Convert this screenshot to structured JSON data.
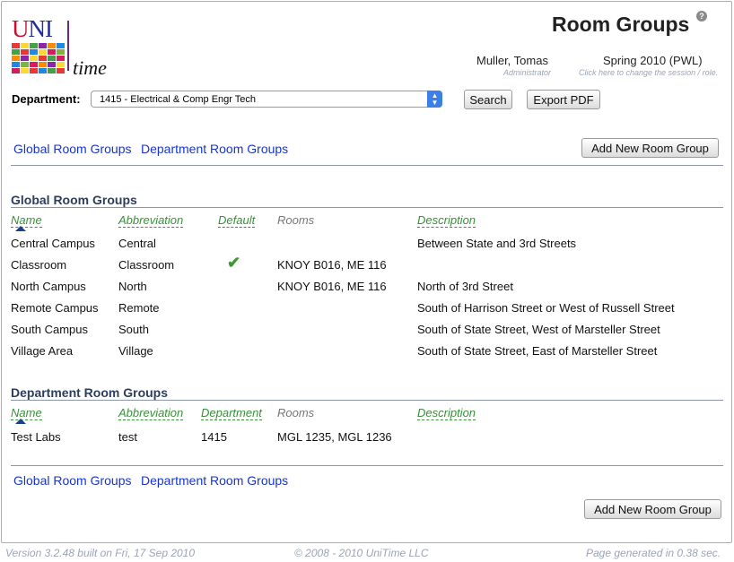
{
  "app": {
    "logo_uni_u": "U",
    "logo_uni_ni": "NI",
    "logo_time": "time",
    "page_title": "Room Groups",
    "help_glyph": "?"
  },
  "session": {
    "user_name": "Muller, Tomas",
    "user_role": "Administrator",
    "term": "Spring 2010 (PWL)",
    "change_hint": "Click here to change the session / role."
  },
  "filter": {
    "department_label": "Department:",
    "department_value": "1415 - Electrical & Comp Engr Tech",
    "search_label": "Search",
    "export_label": "Export PDF"
  },
  "nav": {
    "global_link": "Global Room Groups",
    "department_link": "Department Room Groups",
    "add_label": "Add New Room Group"
  },
  "global_section": {
    "title": "Global Room Groups",
    "columns": [
      "Name",
      "Abbreviation",
      "Default",
      "Rooms",
      "Description"
    ],
    "rows": [
      {
        "name": "Central Campus",
        "abbreviation": "Central",
        "default": false,
        "rooms": "",
        "description": "Between State and 3rd Streets"
      },
      {
        "name": "Classroom",
        "abbreviation": "Classroom",
        "default": true,
        "rooms": "KNOY B016, ME 116",
        "description": ""
      },
      {
        "name": "North Campus",
        "abbreviation": "North",
        "default": false,
        "rooms": "KNOY B016, ME 116",
        "description": "North of 3rd Street"
      },
      {
        "name": "Remote Campus",
        "abbreviation": "Remote",
        "default": false,
        "rooms": "",
        "description": "South of Harrison Street or West of Russell Street"
      },
      {
        "name": "South Campus",
        "abbreviation": "South",
        "default": false,
        "rooms": "",
        "description": "South of State Street, West of Marsteller Street"
      },
      {
        "name": "Village Area",
        "abbreviation": "Village",
        "default": false,
        "rooms": "",
        "description": "South of State Street, East of Marsteller Street"
      }
    ]
  },
  "department_section": {
    "title": "Department Room Groups",
    "columns": [
      "Name",
      "Abbreviation",
      "Department",
      "Rooms",
      "Description"
    ],
    "rows": [
      {
        "name": "Test Labs",
        "abbreviation": "test",
        "department": "1415",
        "rooms": "MGL 1235, MGL 1236",
        "description": ""
      }
    ]
  },
  "footer": {
    "version": "Version 3.2.48 built on Fri, 17 Sep 2010",
    "copyright": "© 2008 - 2010 UniTime LLC",
    "generated": "Page generated in 0.38 sec."
  },
  "colors": {
    "link": "#1a35c9",
    "header_green": "#3a8f3a",
    "section_title": "#2c3e5b",
    "check_green": "#3c9a2e",
    "select_arrow_blue": "#3d7fe8"
  }
}
